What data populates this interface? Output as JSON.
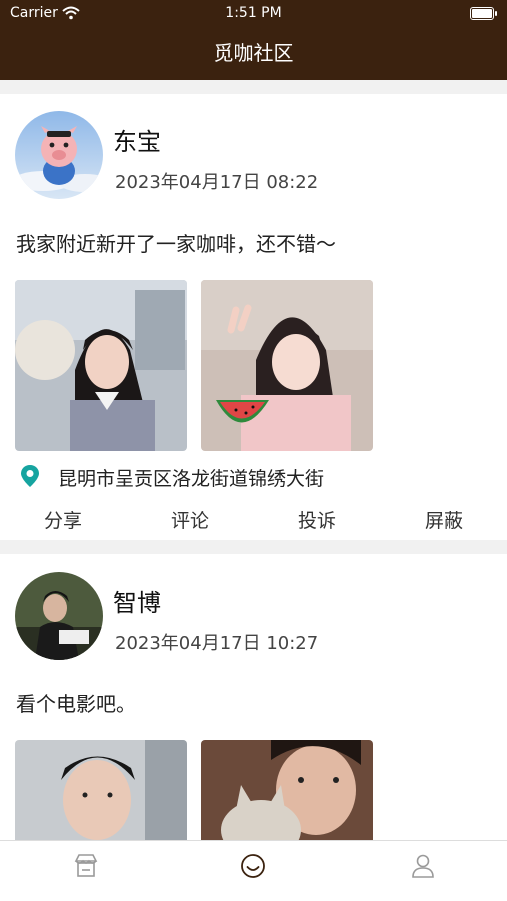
{
  "status_bar": {
    "carrier": "Carrier",
    "time": "1:51 PM"
  },
  "header": {
    "title": "觅咖社区"
  },
  "posts": [
    {
      "name": "东宝",
      "time": "2023年04月17日 08:22",
      "content": "我家附近新开了一家咖啡，还不错～",
      "location": "昆明市呈贡区洛龙街道锦绣大街",
      "actions": [
        "分享",
        "评论",
        "投诉",
        "屏蔽"
      ]
    },
    {
      "name": "智博",
      "time": "2023年04月17日 10:27",
      "content": "看个电影吧。"
    }
  ],
  "icons": {
    "location": "location-pin-icon",
    "tabs": [
      "store-icon",
      "smile-icon",
      "person-icon"
    ]
  },
  "colors": {
    "header_bg": "#3b220f",
    "location_pin": "#16a4a0",
    "tab_active": "#3b220f",
    "tab_inactive": "#9a9a9a"
  }
}
